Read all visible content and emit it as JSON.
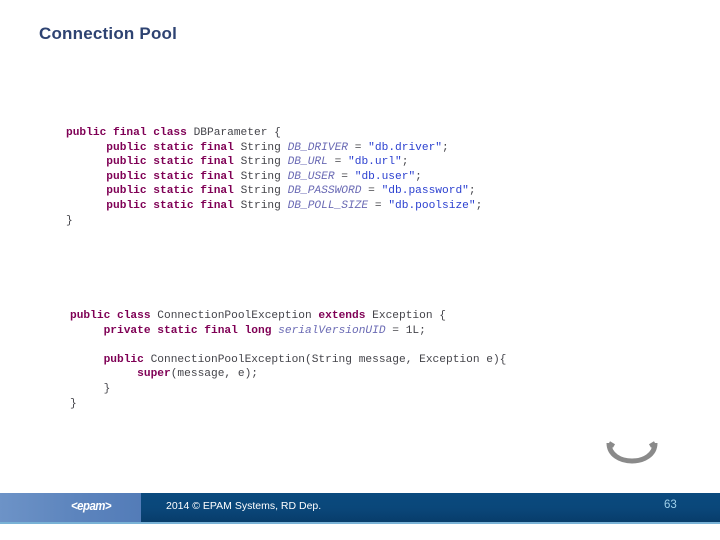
{
  "slide": {
    "title": "Connection Pool",
    "title_color": "#2e4372",
    "background": "#ffffff"
  },
  "code_blocks": [
    {
      "id": "dbparameter",
      "lines": [
        [
          {
            "t": "public final class ",
            "c": "kw"
          },
          {
            "t": "DBParameter {",
            "c": "type"
          }
        ],
        [
          {
            "t": "      ",
            "c": "plain"
          },
          {
            "t": "public static final ",
            "c": "kw"
          },
          {
            "t": "String ",
            "c": "type"
          },
          {
            "t": "DB_DRIVER",
            "c": "const"
          },
          {
            "t": " = ",
            "c": "plain"
          },
          {
            "t": "\"db.driver\"",
            "c": "str"
          },
          {
            "t": ";",
            "c": "plain"
          }
        ],
        [
          {
            "t": "      ",
            "c": "plain"
          },
          {
            "t": "public static final ",
            "c": "kw"
          },
          {
            "t": "String ",
            "c": "type"
          },
          {
            "t": "DB_URL",
            "c": "const"
          },
          {
            "t": " = ",
            "c": "plain"
          },
          {
            "t": "\"db.url\"",
            "c": "str"
          },
          {
            "t": ";",
            "c": "plain"
          }
        ],
        [
          {
            "t": "      ",
            "c": "plain"
          },
          {
            "t": "public static final ",
            "c": "kw"
          },
          {
            "t": "String ",
            "c": "type"
          },
          {
            "t": "DB_USER",
            "c": "const"
          },
          {
            "t": " = ",
            "c": "plain"
          },
          {
            "t": "\"db.user\"",
            "c": "str"
          },
          {
            "t": ";",
            "c": "plain"
          }
        ],
        [
          {
            "t": "      ",
            "c": "plain"
          },
          {
            "t": "public static final ",
            "c": "kw"
          },
          {
            "t": "String ",
            "c": "type"
          },
          {
            "t": "DB_PASSWORD",
            "c": "const"
          },
          {
            "t": " = ",
            "c": "plain"
          },
          {
            "t": "\"db.password\"",
            "c": "str"
          },
          {
            "t": ";",
            "c": "plain"
          }
        ],
        [
          {
            "t": "      ",
            "c": "plain"
          },
          {
            "t": "public static final ",
            "c": "kw"
          },
          {
            "t": "String ",
            "c": "type"
          },
          {
            "t": "DB_POLL_SIZE",
            "c": "const"
          },
          {
            "t": " = ",
            "c": "plain"
          },
          {
            "t": "\"db.poolsize\"",
            "c": "str"
          },
          {
            "t": ";",
            "c": "plain"
          }
        ],
        [
          {
            "t": "}",
            "c": "plain"
          }
        ]
      ]
    },
    {
      "id": "exception",
      "lines": [
        [
          {
            "t": "public class ",
            "c": "kw"
          },
          {
            "t": "ConnectionPoolException ",
            "c": "type"
          },
          {
            "t": "extends ",
            "c": "kw"
          },
          {
            "t": "Exception {",
            "c": "type"
          }
        ],
        [
          {
            "t": "     ",
            "c": "plain"
          },
          {
            "t": "private static final long ",
            "c": "kw"
          },
          {
            "t": "serialVersionUID",
            "c": "const"
          },
          {
            "t": " = ",
            "c": "plain"
          },
          {
            "t": "1L;",
            "c": "num"
          }
        ],
        [
          {
            "t": " ",
            "c": "plain"
          }
        ],
        [
          {
            "t": "     ",
            "c": "plain"
          },
          {
            "t": "public ",
            "c": "kw"
          },
          {
            "t": "ConnectionPoolException(String message, Exception e){",
            "c": "type"
          }
        ],
        [
          {
            "t": "          ",
            "c": "plain"
          },
          {
            "t": "super",
            "c": "kw"
          },
          {
            "t": "(message, e);",
            "c": "type"
          }
        ],
        [
          {
            "t": "     }",
            "c": "plain"
          }
        ],
        [
          {
            "t": "}",
            "c": "plain"
          }
        ]
      ]
    }
  ],
  "footer": {
    "logo_text": "<epam>",
    "copyright": "2014 © EPAM Systems, RD Dep.",
    "page_number": "63",
    "bar_color": "#0a477a",
    "logo_block_color": "#5c84bd",
    "underline_color": "#79b2d6",
    "page_number_color": "#9fd0ea"
  },
  "decoration": {
    "swoosh_color": "#8a8a8a"
  }
}
